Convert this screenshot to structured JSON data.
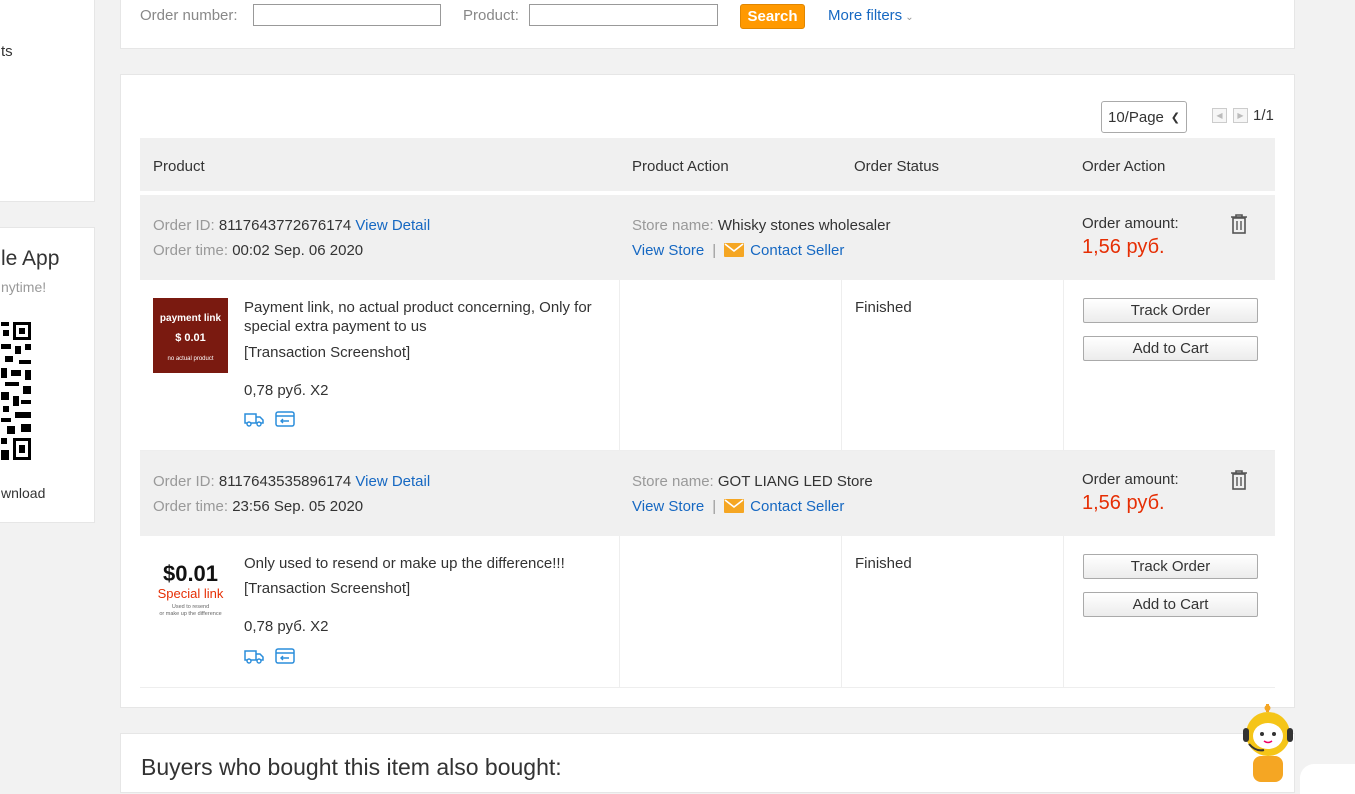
{
  "sidebar": {
    "fragment_top": "ts",
    "app_title": "le App",
    "app_subtitle": "nytime!",
    "download": "wnload"
  },
  "filter": {
    "order_number_label": "Order number:",
    "order_number_value": "",
    "product_label": "Product:",
    "product_value": "",
    "search_label": "Search",
    "more_filters_label": "More filters"
  },
  "pagination": {
    "page_size": "10/Page",
    "page_count": "1/1"
  },
  "table": {
    "headers": [
      "Product",
      "Product Action",
      "Order Status",
      "Order Action"
    ]
  },
  "labels": {
    "order_id": "Order ID:",
    "order_time": "Order time:",
    "view_detail": "View Detail",
    "store_name": "Store name:",
    "view_store": "View Store",
    "contact_seller": "Contact Seller",
    "order_amount": "Order amount:",
    "transaction_screenshot": "[Transaction Screenshot]",
    "track_order": "Track Order",
    "add_to_cart": "Add to Cart"
  },
  "orders": [
    {
      "id": "8117643772676174",
      "time": "00:02 Sep. 06 2020",
      "store": "Whisky stones wholesaler",
      "amount": "1,56 руб.",
      "product_title": "Payment link, no actual product concerning, Only for special extra payment to us",
      "price_qty": "0,78 руб. X2",
      "status": "Finished",
      "thumb": {
        "line1": "payment link",
        "line2": "$ 0.01",
        "line3": "no actual product"
      }
    },
    {
      "id": "8117643535896174",
      "time": "23:56 Sep. 05 2020",
      "store": "GOT LIANG LED Store",
      "amount": "1,56 руб.",
      "product_title": "Only used to resend or make up the difference!!!",
      "price_qty": "0,78 руб. X2",
      "status": "Finished",
      "thumb": {
        "line1": "$0.01",
        "line2": "Special link",
        "line3": "Used to resend",
        "line4": "or make up the difference"
      }
    }
  ],
  "bottom": {
    "title": "Buyers who bought this item also bought:"
  },
  "colors": {
    "link": "#1668c2",
    "accent": "#ff9900",
    "price": "#e62e04",
    "header_bg": "#f0f0f0"
  },
  "icons": [
    "trash-icon",
    "mail-icon",
    "shipping-icon",
    "return-icon",
    "chevron-down-icon",
    "qr-code-icon",
    "mascot-icon"
  ]
}
